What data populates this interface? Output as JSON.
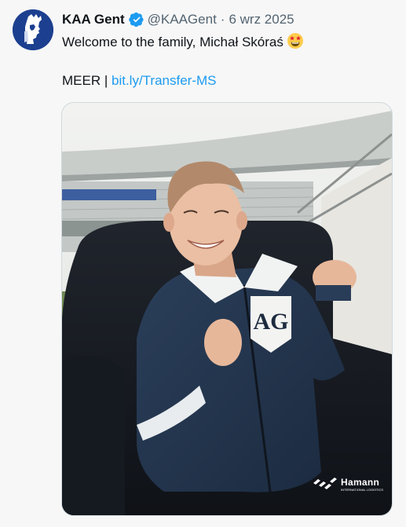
{
  "tweet": {
    "author_name": "KAA Gent",
    "handle": "@KAAGent",
    "separator": "·",
    "date": "6 wrz 2025",
    "text_line1": "Welcome to the family, Michał Skóraś",
    "text_prefix": "MEER | ",
    "link_text": "bit.ly/Transfer-MS"
  },
  "media": {
    "sponsor_logo_text": "Hamann",
    "sponsor_logo_subtext": "INTERNATIONAL LOGISTICS"
  },
  "icons": {
    "verified": "verified-badge-icon",
    "emoji": "star-struck-emoji-icon"
  },
  "colors": {
    "link": "#1d9bf0",
    "verified": "#1d9bf0",
    "secondary_text": "#536471",
    "club_blue": "#1c3f8f"
  }
}
